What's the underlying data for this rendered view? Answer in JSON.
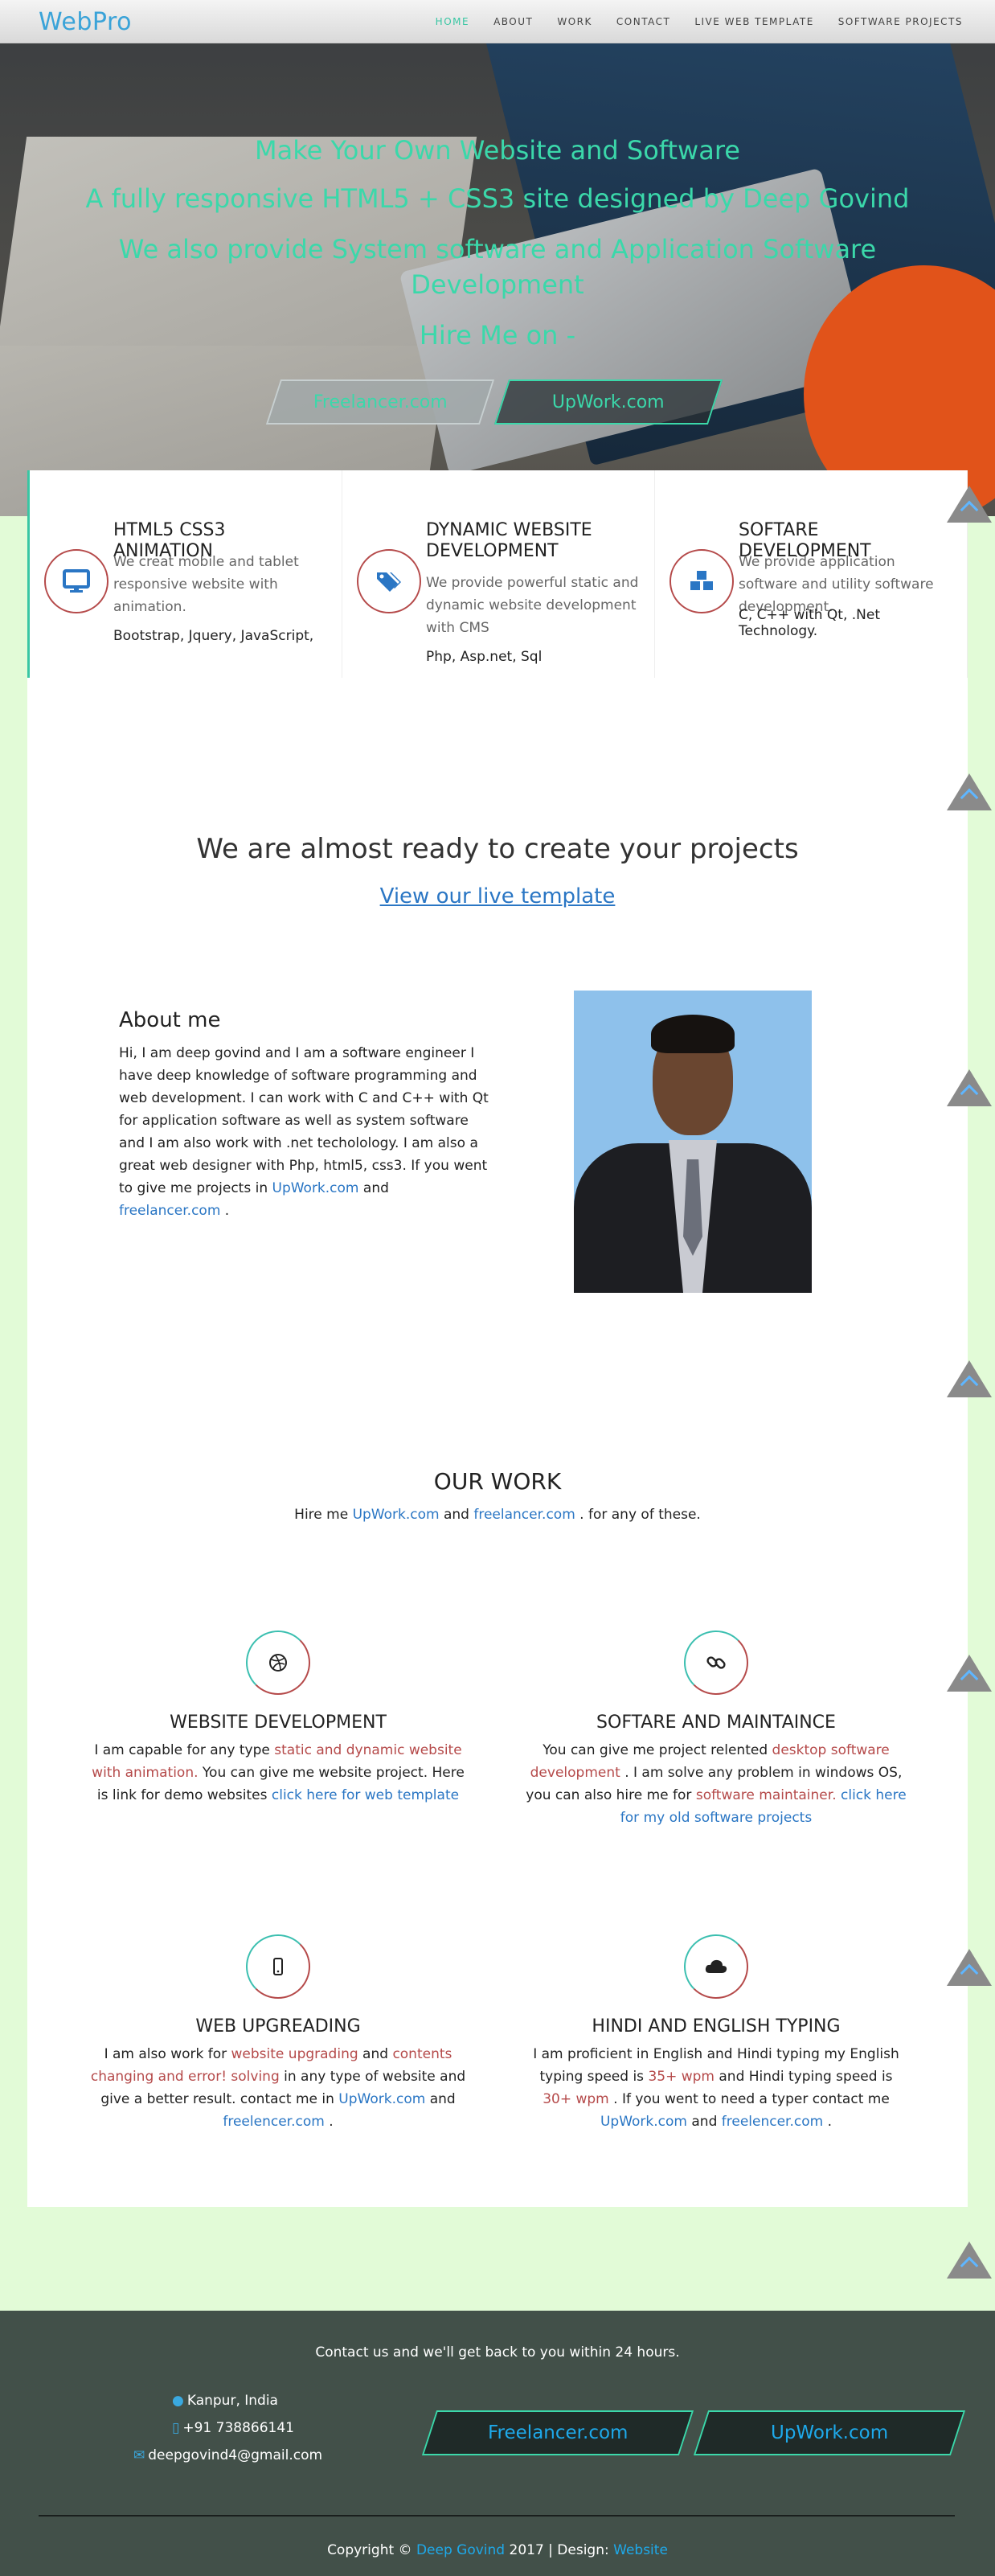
{
  "nav": {
    "brand": "WebPro",
    "items": [
      "HOME",
      "ABOUT",
      "WORK",
      "CONTACT",
      "LIVE WEB TEMPLATE",
      "SOFTWARE PROJECTS"
    ]
  },
  "hero": {
    "line1": "Make Your Own Website and Software",
    "line2": "A fully responsive HTML5 + CSS3 site designed by Deep Govind",
    "line3": "We also provide System software and Application Software Development",
    "line4": "Hire Me on -",
    "btn_freelancer": "Freelancer.com",
    "btn_upwork": "UpWork.com"
  },
  "features": [
    {
      "title": "HTML5 CSS3 ANIMATION",
      "desc": "We creat mobile and tablet responsive website with animation.",
      "extra": "Bootstrap, Jquery, JavaScript,",
      "icon": "monitor-icon"
    },
    {
      "title": "DYNAMIC WEBSITE DEVELOPMENT",
      "desc": "We provide powerful static and dynamic website development with CMS",
      "extra": "Php, Asp.net, Sql",
      "icon": "tags-icon"
    },
    {
      "title": "SOFTARE DEVELOPMENT",
      "desc": "We provide application software and utility software development.",
      "extra": "C, C++ with Qt, .Net Technology.",
      "icon": "cubes-icon"
    }
  ],
  "ready": {
    "title": "We are almost ready to create your projects",
    "link": "View our live template"
  },
  "about": {
    "title": "About me",
    "text": "Hi, I am deep govind and I am a software engineer I have deep knowledge of software programming and web development. I can work with C and C++ with Qt for application software as well as system software and I am also work with .net techolology. I am also a great web designer with Php, html5, css3. If you went to give me projects in",
    "upwork": "UpWork.com",
    "and": "and",
    "freelancer": "freelancer.com",
    "end": "."
  },
  "work": {
    "title": "OUR WORK",
    "sub_pre": "Hire me",
    "sub_upwork": "UpWork.com",
    "sub_and": "and",
    "sub_freelancer": "freelancer.com",
    "sub_post": ". for any of these."
  },
  "services": {
    "web": {
      "title": "WEBSITE DEVELOPMENT",
      "p1": "I am capable for any type",
      "r1": "static and dynamic website with animation.",
      "p2": "You can give me website project. Here is link for demo websites",
      "l1": "click here for web template"
    },
    "soft": {
      "title": "SOFTARE AND MAINTAINCE",
      "p1": "You can give me project relented",
      "r1": "desktop software development",
      "p2": ". I am solve any problem in windows OS, you can also hire me for",
      "r2": "software maintainer.",
      "l1": "click here for my old software projects"
    },
    "upgrade": {
      "title": "WEB UPGREADING",
      "p1": "I am also work for",
      "r1": "website upgrading",
      "p2": "and",
      "r2": "contents changing and error! solving",
      "p3": "in any type of website and give a better result. contact me in",
      "l1": "UpWork.com",
      "p4": "and",
      "l2": "freelencer.com",
      "p5": "."
    },
    "typing": {
      "title": "HINDI AND ENGLISH TYPING",
      "p1": "I am proficient in English and Hindi typing my English typing speed is",
      "r1": "35+ wpm",
      "p2": "and Hindi typing speed is",
      "r2": "30+ wpm",
      "p3": ". If you went to need a typer contact me",
      "l1": "UpWork.com",
      "p4": "and",
      "l2": "freelencer.com",
      "p5": "."
    }
  },
  "footer": {
    "contact_line": "Contact us and we'll get back to you within 24 hours.",
    "location": "Kanpur, India",
    "phone": "+91 738866141",
    "email": "deepgovind4@gmail.com",
    "btn_freelancer": "Freelancer.com",
    "btn_upwork": "UpWork.com",
    "copy_pre": "Copyright ©",
    "copy_name": "Deep Govind",
    "copy_mid": "2017 | Design:",
    "copy_link": "Website"
  },
  "colors": {
    "accent": "#3bd8aa",
    "link": "#2a76c4",
    "highlight": "#b54a4a",
    "page_bg": "#e2fbd7",
    "footer_bg": "#425049"
  }
}
